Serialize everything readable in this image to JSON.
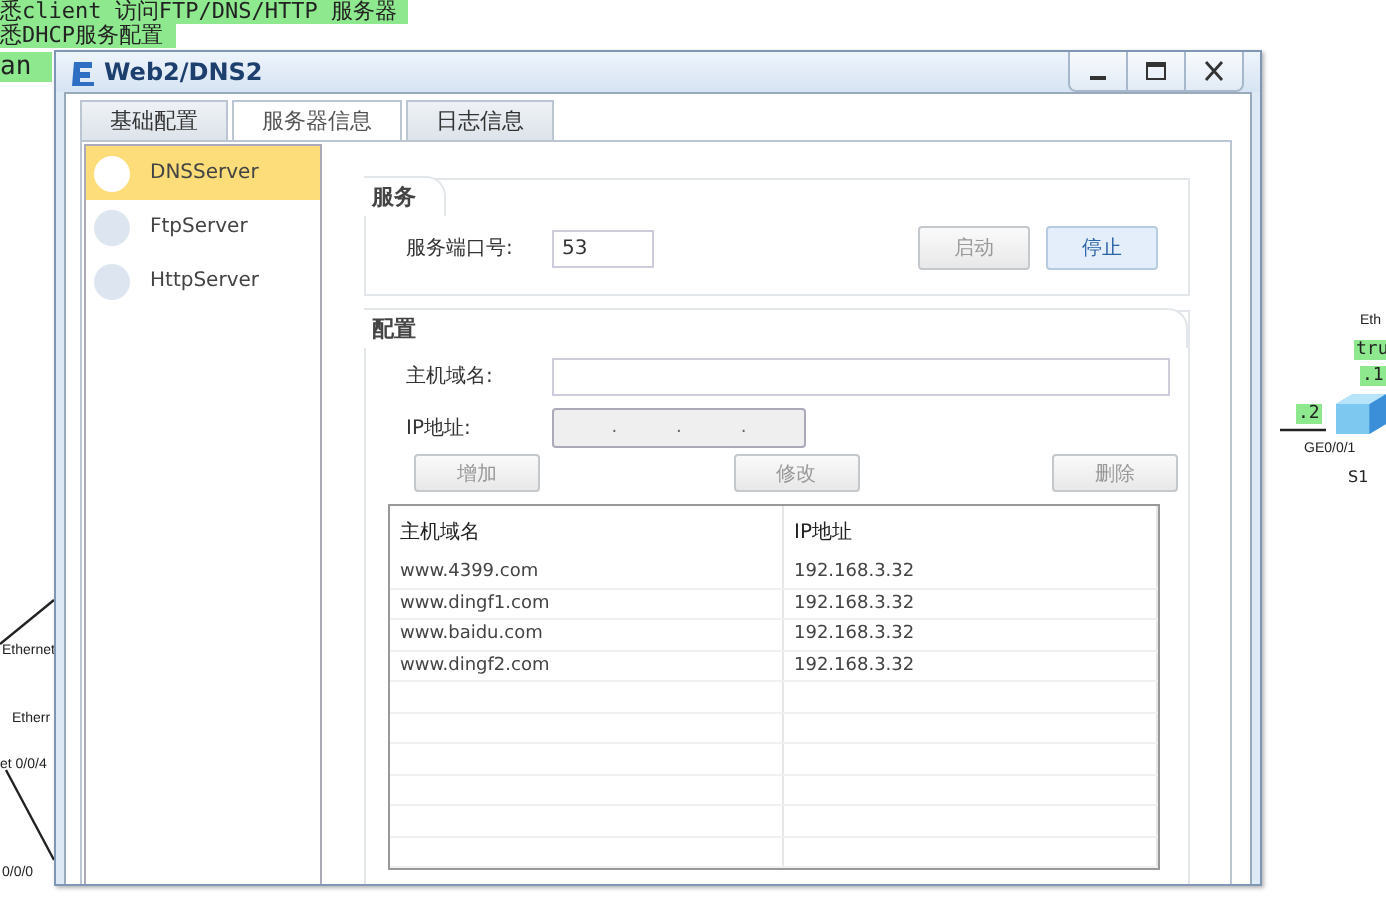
{
  "background": {
    "notes": [
      {
        "text": "悉client 访问FTP/DNS/HTTP 服务器"
      },
      {
        "text": "悉DHCP服务配置"
      },
      {
        "text": "an"
      }
    ],
    "port_labels": [
      {
        "text": "Ethernet"
      },
      {
        "text": "Etherr"
      },
      {
        "text": "et 0/0/4"
      },
      {
        "text": "0/0/0"
      },
      {
        "text": "Eth"
      },
      {
        "text": "GE0/0/1"
      }
    ],
    "tags": [
      {
        "text": "tru"
      },
      {
        "text": ".1"
      },
      {
        "text": ".2"
      }
    ],
    "device_name": "S1"
  },
  "window": {
    "title": "Web2/DNS2"
  },
  "tabs": [
    {
      "label": "基础配置",
      "selected": false
    },
    {
      "label": "服务器信息",
      "selected": true
    },
    {
      "label": "日志信息",
      "selected": false
    }
  ],
  "servers": [
    {
      "name": "DNSServer",
      "selected": true
    },
    {
      "name": "FtpServer",
      "selected": false
    },
    {
      "name": "HttpServer",
      "selected": false
    }
  ],
  "service": {
    "title": "服务",
    "port_label": "服务端口号:",
    "port": "53",
    "buttons": [
      {
        "label": "启动",
        "disabled": true
      },
      {
        "label": "停止",
        "disabled": false
      }
    ]
  },
  "config": {
    "title": "配置",
    "host_label": "主机域名:",
    "ip_label": "IP地址:",
    "ip_separators": [
      ".",
      ".",
      "."
    ],
    "buttons": [
      {
        "label": "增加",
        "disabled": true
      },
      {
        "label": "修改",
        "disabled": true
      },
      {
        "label": "删除",
        "disabled": true
      }
    ],
    "table": {
      "columns": [
        "主机域名",
        "IP地址"
      ],
      "rows": [
        [
          "www.4399.com",
          "192.168.3.32"
        ],
        [
          "www.dingf1.com",
          "192.168.3.32"
        ],
        [
          "www.baidu.com",
          "192.168.3.32"
        ],
        [
          "www.dingf2.com",
          "192.168.3.32"
        ]
      ]
    }
  }
}
